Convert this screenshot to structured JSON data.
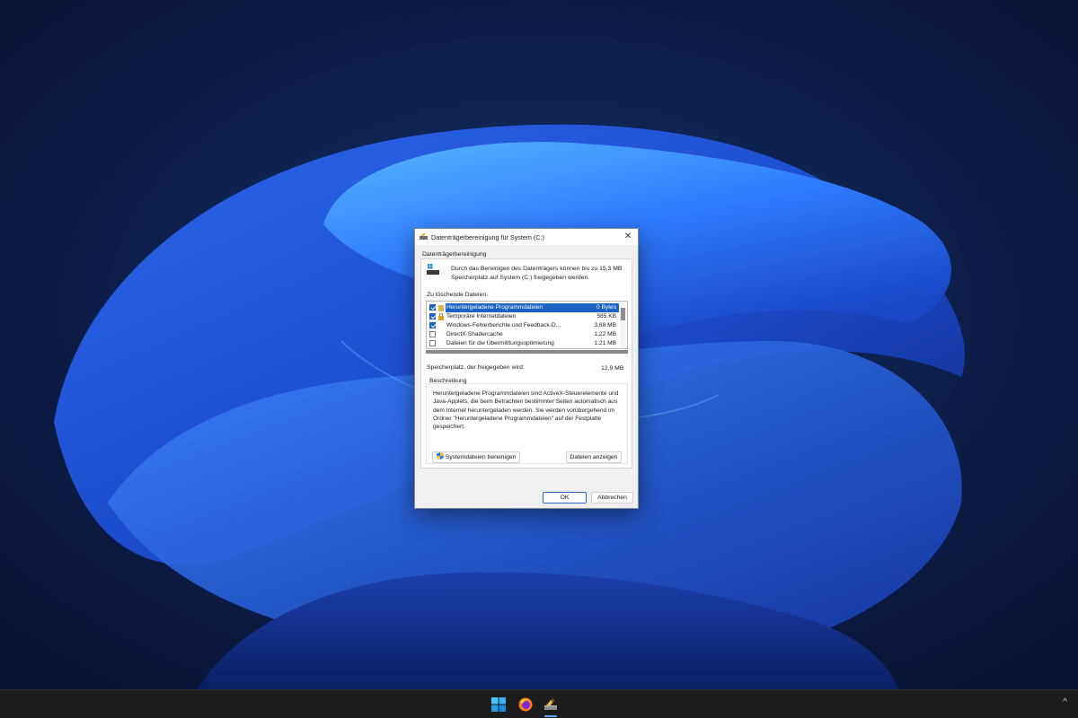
{
  "dialog": {
    "title": "Datenträgerbereinigung für System (C:)",
    "close_label": "✕",
    "tab": "Datenträgerbereinigung",
    "intro": "Durch das Bereinigen des Datenträgers können bis zu 15,3 MB Speicherplatz auf System (C:) freigegeben werden.",
    "files_label": "Zu löschende Dateien:",
    "files": [
      {
        "name": "Heruntergeladene Programmdateien",
        "size": "0 Bytes",
        "checked": true,
        "selected": true
      },
      {
        "name": "Temporäre Internetdateien",
        "size": "585 KB",
        "checked": true,
        "selected": false
      },
      {
        "name": "Windows-Fehlerberichte und Feedback-D...",
        "size": "3,68 MB",
        "checked": true,
        "selected": false
      },
      {
        "name": "DirectX-Shadercache",
        "size": "1,22 MB",
        "checked": false,
        "selected": false
      },
      {
        "name": "Dateien für die Übermittlungsoptimierung",
        "size": "1,21 MB",
        "checked": false,
        "selected": false
      }
    ],
    "space_label": "Speicherplatz, der freigegeben wird:",
    "space_value": "12,9 MB",
    "description_label": "Beschreibung",
    "description": "Heruntergeladene Programmdateien sind ActiveX-Steuerelemente und Java-Applets, die beim Betrachten bestimmter Seiten automatisch aus dem Internet heruntergeladen werden. Sie werden vorübergehend im Ordner \"Heruntergeladene Programmdateien\" auf der Festplatte gespeichert.",
    "buttons": {
      "system_cleanup": "Systemdateien bereinigen",
      "show_files": "Dateien anzeigen",
      "ok": "OK",
      "cancel": "Abbrechen"
    }
  },
  "taskbar": {
    "icons": [
      "windows-start-icon",
      "firefox-icon",
      "disk-cleanup-icon"
    ],
    "active": "disk-cleanup-icon",
    "overflow_label": "^"
  },
  "colors": {
    "accent": "#1a63c4",
    "wallpaper_base": "#0a1a3c",
    "taskbar": "#1c1c1c"
  }
}
